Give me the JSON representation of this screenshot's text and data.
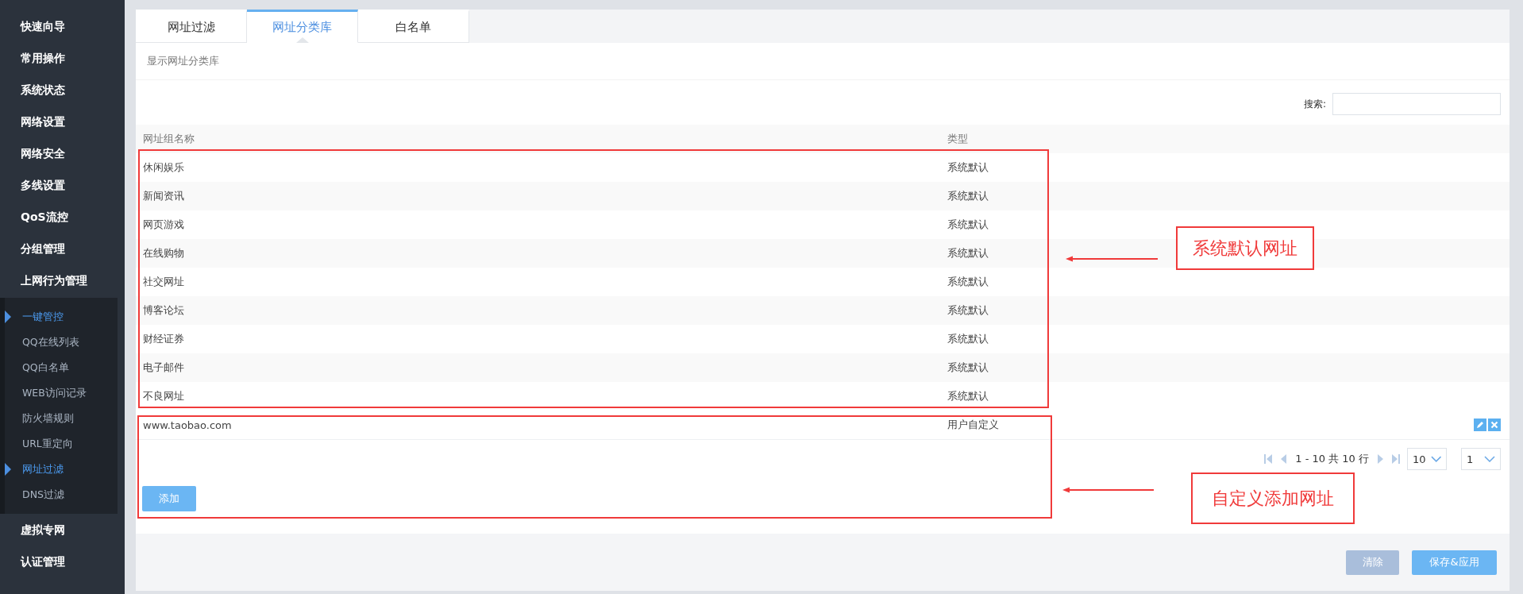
{
  "sidebar": {
    "items": [
      {
        "label": "快速向导"
      },
      {
        "label": "常用操作"
      },
      {
        "label": "系统状态"
      },
      {
        "label": "网络设置"
      },
      {
        "label": "网络安全"
      },
      {
        "label": "多线设置"
      },
      {
        "label": "QoS流控"
      },
      {
        "label": "分组管理"
      },
      {
        "label": "上网行为管理",
        "children": [
          {
            "label": "一键管控",
            "selected": true
          },
          {
            "label": "QQ在线列表",
            "selected": false
          },
          {
            "label": "QQ白名单",
            "selected": false
          },
          {
            "label": "WEB访问记录",
            "selected": false
          },
          {
            "label": "防火墙规则",
            "selected": false
          },
          {
            "label": "URL重定向",
            "selected": false
          },
          {
            "label": "网址过滤",
            "selected": true
          },
          {
            "label": "DNS过滤",
            "selected": false
          }
        ]
      },
      {
        "label": "虚拟专网"
      },
      {
        "label": "认证管理"
      }
    ]
  },
  "tabs": [
    {
      "label": "网址过滤",
      "selected": false
    },
    {
      "label": "网址分类库",
      "selected": true
    },
    {
      "label": "白名单",
      "selected": false
    }
  ],
  "section_title": "显示网址分类库",
  "search": {
    "label": "搜索:"
  },
  "table": {
    "columns": [
      "网址组名称",
      "类型"
    ],
    "rows": [
      {
        "kind": "default",
        "name": "休闲娱乐",
        "type": "系统默认"
      },
      {
        "kind": "default",
        "name": "新闻资讯",
        "type": "系统默认"
      },
      {
        "kind": "default",
        "name": "网页游戏",
        "type": "系统默认"
      },
      {
        "kind": "default",
        "name": "在线购物",
        "type": "系统默认"
      },
      {
        "kind": "default",
        "name": "社交网址",
        "type": "系统默认"
      },
      {
        "kind": "default",
        "name": "博客论坛",
        "type": "系统默认"
      },
      {
        "kind": "default",
        "name": "财经证券",
        "type": "系统默认"
      },
      {
        "kind": "default",
        "name": "电子邮件",
        "type": "系统默认"
      },
      {
        "kind": "default",
        "name": "不良网址",
        "type": "系统默认"
      },
      {
        "kind": "custom",
        "name": "www.taobao.com",
        "type": "用户自定义"
      }
    ]
  },
  "pagination": {
    "summary": "1 - 10 共 10 行",
    "page_size": "10",
    "page": "1"
  },
  "add_button": "添加",
  "buttons": [
    {
      "label": "清除",
      "disabled": true
    },
    {
      "label": "保存&应用",
      "disabled": false
    }
  ],
  "annotations": [
    {
      "label": "系统默认网址"
    },
    {
      "label": "自定义添加网址"
    }
  ]
}
